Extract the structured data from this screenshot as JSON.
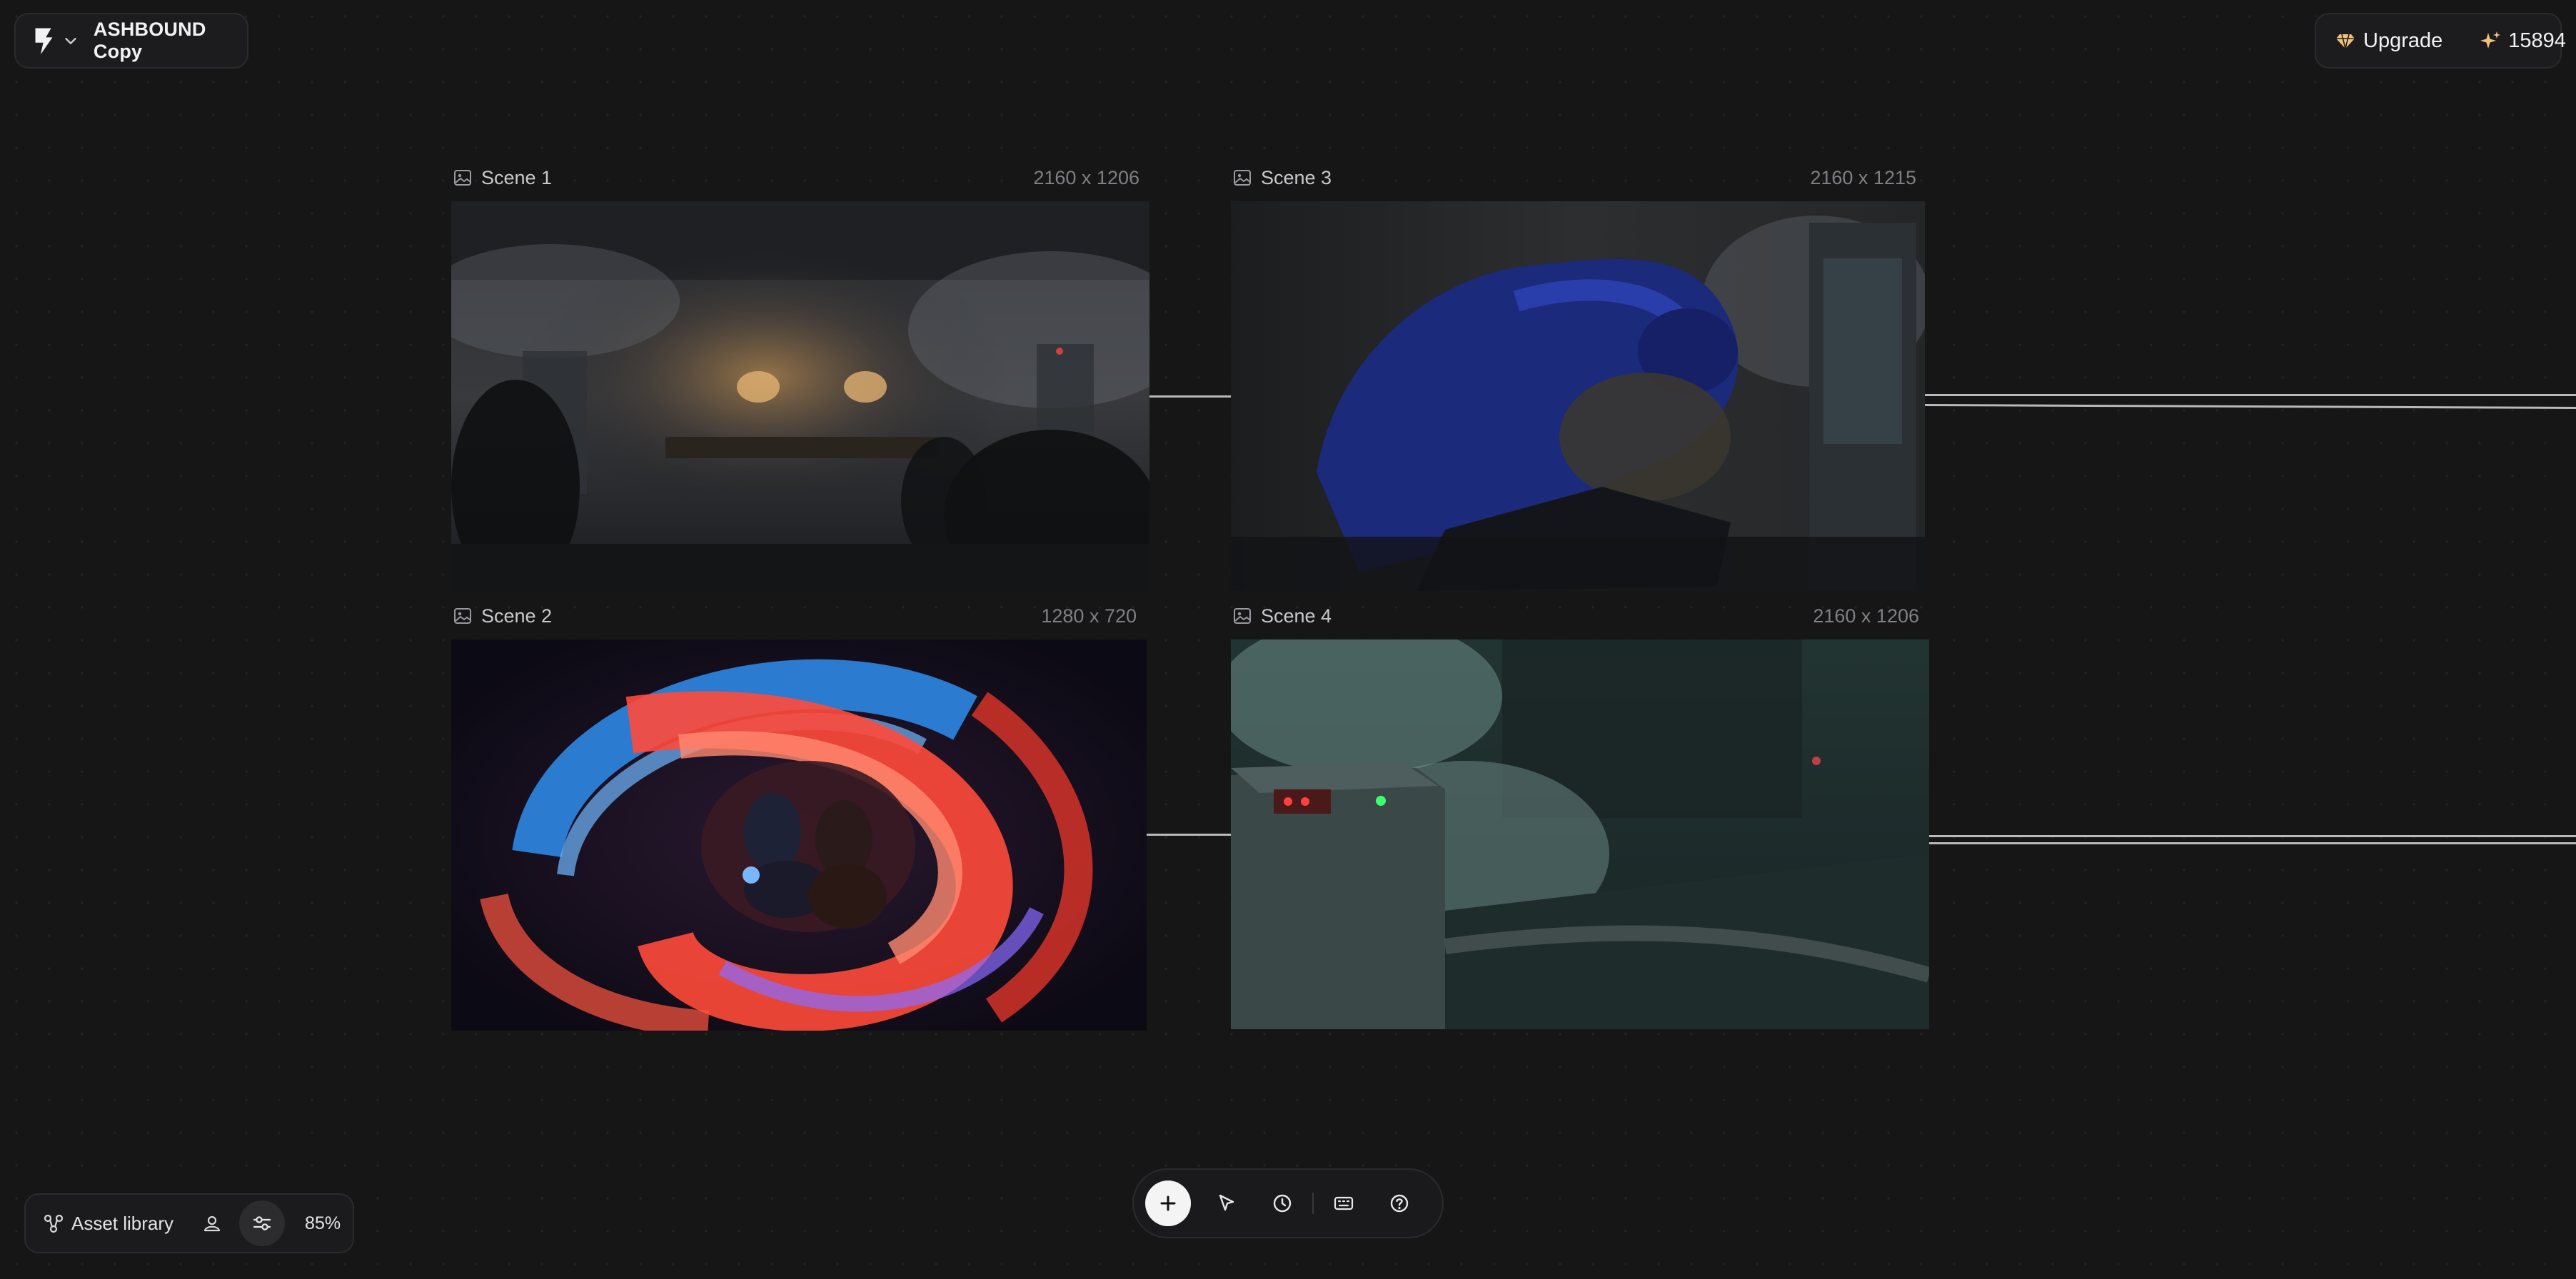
{
  "project": {
    "title": "ASHBOUND Copy",
    "logo_icon": "brand-logo-icon",
    "menu_icon": "chevron-down-icon"
  },
  "header_right": {
    "upgrade_label": "Upgrade",
    "upgrade_icon": "diamond-icon",
    "credits": "15894",
    "credits_icon": "sparkle-icon",
    "accent_color": "#f3c27b"
  },
  "scenes": [
    {
      "name": "Scene 1",
      "dimensions": "2160 x 1206",
      "icon": "image-icon"
    },
    {
      "name": "Scene 2",
      "dimensions": "1280 x 720",
      "icon": "image-icon"
    },
    {
      "name": "Scene 3",
      "dimensions": "2160 x 1215",
      "icon": "image-icon"
    },
    {
      "name": "Scene 4",
      "dimensions": "2160 x 1206",
      "icon": "image-icon"
    }
  ],
  "bottom_left": {
    "asset_library_label": "Asset library",
    "asset_icon": "nodes-icon",
    "user_icon": "user-icon",
    "settings_icon": "sliders-icon",
    "zoom": "85%"
  },
  "toolbar": {
    "tools": [
      "plus-icon",
      "cursor-icon",
      "clock-icon",
      "keyboard-icon",
      "help-icon"
    ]
  }
}
